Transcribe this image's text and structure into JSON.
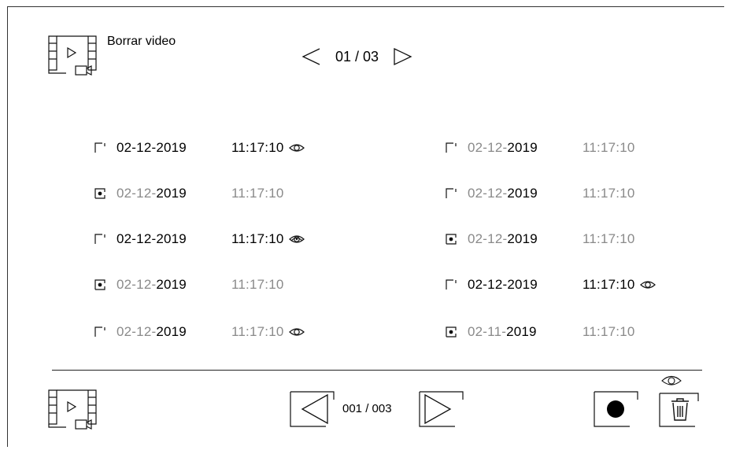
{
  "header": {
    "title": "Borrar video",
    "icon": "video-file-icon",
    "pager": {
      "label": "01 / 03",
      "prev_icon": "triangle-left-icon",
      "next_icon": "triangle-right-icon"
    }
  },
  "records": [
    {
      "col": 0,
      "checkbox": "empty",
      "date_a": "02-12-2019",
      "date_b": "",
      "date_style": "bold",
      "time": "11:17:10",
      "time_style": "black",
      "eye": "eye-icon"
    },
    {
      "col": 0,
      "checkbox": "checked",
      "date_a": "02-12-",
      "date_b": "2019",
      "date_style": "mixed",
      "time": "11:17:10",
      "time_style": "grey",
      "eye": ""
    },
    {
      "col": 0,
      "checkbox": "empty",
      "date_a": "02-12-2019",
      "date_b": "",
      "date_style": "bold",
      "time": "11:17:10",
      "time_style": "black",
      "eye": "eye-double-icon"
    },
    {
      "col": 0,
      "checkbox": "checked",
      "date_a": "02-12-",
      "date_b": "2019",
      "date_style": "mixed",
      "time": "11:17:10",
      "time_style": "grey",
      "eye": ""
    },
    {
      "col": 0,
      "checkbox": "empty",
      "date_a": "02-12-",
      "date_b": "2019",
      "date_style": "mixed",
      "time": "11:17:10",
      "time_style": "grey",
      "eye": "eye-icon"
    },
    {
      "col": 1,
      "checkbox": "empty",
      "date_a": "02-12-",
      "date_b": "2019",
      "date_style": "mixed",
      "time": "11:17:10",
      "time_style": "grey",
      "eye": ""
    },
    {
      "col": 1,
      "checkbox": "empty",
      "date_a": "02-12-",
      "date_b": "2019",
      "date_style": "mixed",
      "time": "11:17:10",
      "time_style": "grey",
      "eye": ""
    },
    {
      "col": 1,
      "checkbox": "checked",
      "date_a": "02-12-",
      "date_b": "2019",
      "date_style": "mixed",
      "time": "11:17:10",
      "time_style": "grey",
      "eye": ""
    },
    {
      "col": 1,
      "checkbox": "empty",
      "date_a": "02-12-2019",
      "date_b": "",
      "date_style": "bold",
      "time": "11:17:10",
      "time_style": "black",
      "eye": "eye-icon"
    },
    {
      "col": 1,
      "checkbox": "checked",
      "date_a": "02-11-",
      "date_b": "2019",
      "date_style": "mixed",
      "time": "11:17:10",
      "time_style": "grey",
      "eye": ""
    }
  ],
  "footer": {
    "left_icon": "video-file-icon",
    "pager": {
      "label": "001 / 003",
      "prev_icon": "triangle-left-icon",
      "next_icon": "triangle-right-icon"
    },
    "record_icon": "record-dot-icon",
    "delete_icon": "trash-icon",
    "delete_badge_icon": "eye-icon"
  }
}
